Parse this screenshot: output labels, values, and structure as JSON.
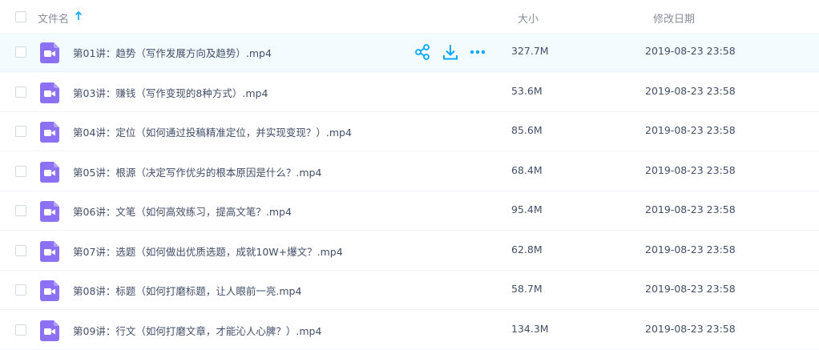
{
  "header": {
    "name_label": "文件名",
    "size_label": "大小",
    "date_label": "修改日期",
    "sort_icon": "arrow-up-icon"
  },
  "colors": {
    "accent": "#06a7ff",
    "video_icon": "#8c71f4",
    "hover_row": "#f4fbff"
  },
  "icons": {
    "file": "video-file-icon",
    "share": "share-icon",
    "download": "download-icon",
    "more": "more-icon"
  },
  "files": [
    {
      "name": "第01讲：趋势（写作发展方向及趋势）.mp4",
      "size": "327.7M",
      "date": "2019-08-23 23:58"
    },
    {
      "name": "第03讲：赚钱（写作变现的8种方式）.mp4",
      "size": "53.6M",
      "date": "2019-08-23 23:58"
    },
    {
      "name": "第04讲：定位（如何通过投稿精准定位，并实现变现？）.mp4",
      "size": "85.6M",
      "date": "2019-08-23 23:58"
    },
    {
      "name": "第05讲：根源（决定写作优劣的根本原因是什么？.mp4",
      "size": "68.4M",
      "date": "2019-08-23 23:58"
    },
    {
      "name": "第06讲：文笔（如何高效练习，提高文笔？.mp4",
      "size": "95.4M",
      "date": "2019-08-23 23:58"
    },
    {
      "name": "第07讲：选题（如何做出优质选题，成就10W+爆文？.mp4",
      "size": "62.8M",
      "date": "2019-08-23 23:58"
    },
    {
      "name": "第08讲：标题（如何打磨标题，让人眼前一亮.mp4",
      "size": "58.7M",
      "date": "2019-08-23 23:58"
    },
    {
      "name": "第09讲：行文（如何打磨文章，才能沁人心脾？）.mp4",
      "size": "134.3M",
      "date": "2019-08-23 23:58"
    }
  ]
}
